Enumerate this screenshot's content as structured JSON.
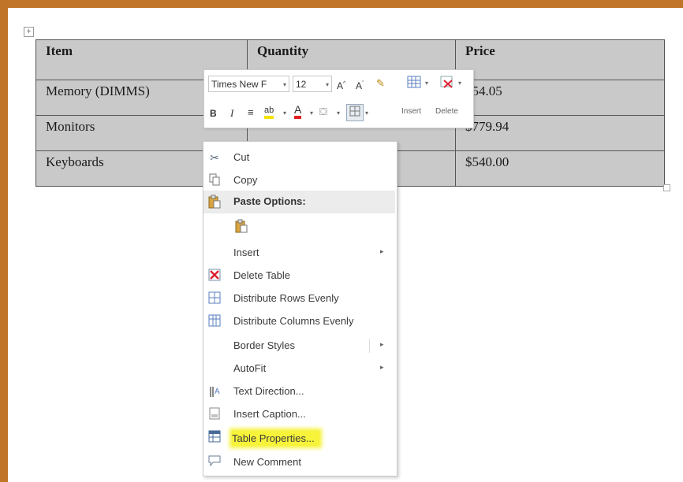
{
  "table": {
    "headers": [
      "Item",
      "Quantity",
      "Price"
    ],
    "rows": [
      [
        "Memory (DIMMS)",
        "",
        "$54.05"
      ],
      [
        "Monitors",
        "",
        "$779.94"
      ],
      [
        "Keyboards",
        "",
        "$540.00"
      ]
    ]
  },
  "minibar": {
    "font_name": "Times New F",
    "font_size": "12",
    "insert_label": "Insert",
    "delete_label": "Delete"
  },
  "context_menu": {
    "items": [
      {
        "label": "Cut",
        "icon": "scissors-icon"
      },
      {
        "label": "Copy",
        "icon": "copy-icon"
      },
      {
        "label": "Paste Options:",
        "icon": "paste-icon"
      },
      {
        "label": "",
        "icon": "paste-keep-formatting-icon"
      },
      {
        "label": "Insert",
        "icon": ""
      },
      {
        "label": "Delete Table",
        "icon": "delete-table-icon"
      },
      {
        "label": "Distribute Rows Evenly",
        "icon": "distribute-rows-icon"
      },
      {
        "label": "Distribute Columns Evenly",
        "icon": "distribute-columns-icon"
      },
      {
        "label": "Border Styles",
        "icon": ""
      },
      {
        "label": "AutoFit",
        "icon": ""
      },
      {
        "label": "Text Direction...",
        "icon": "text-direction-icon"
      },
      {
        "label": "Insert Caption...",
        "icon": "insert-caption-icon"
      },
      {
        "label": "Table Properties...",
        "icon": "table-properties-icon"
      },
      {
        "label": "New Comment",
        "icon": "new-comment-icon"
      }
    ]
  },
  "colors": {
    "frame": "#c07428",
    "cell_fill": "#c9c9c9",
    "highlight": "#f6f33a"
  }
}
